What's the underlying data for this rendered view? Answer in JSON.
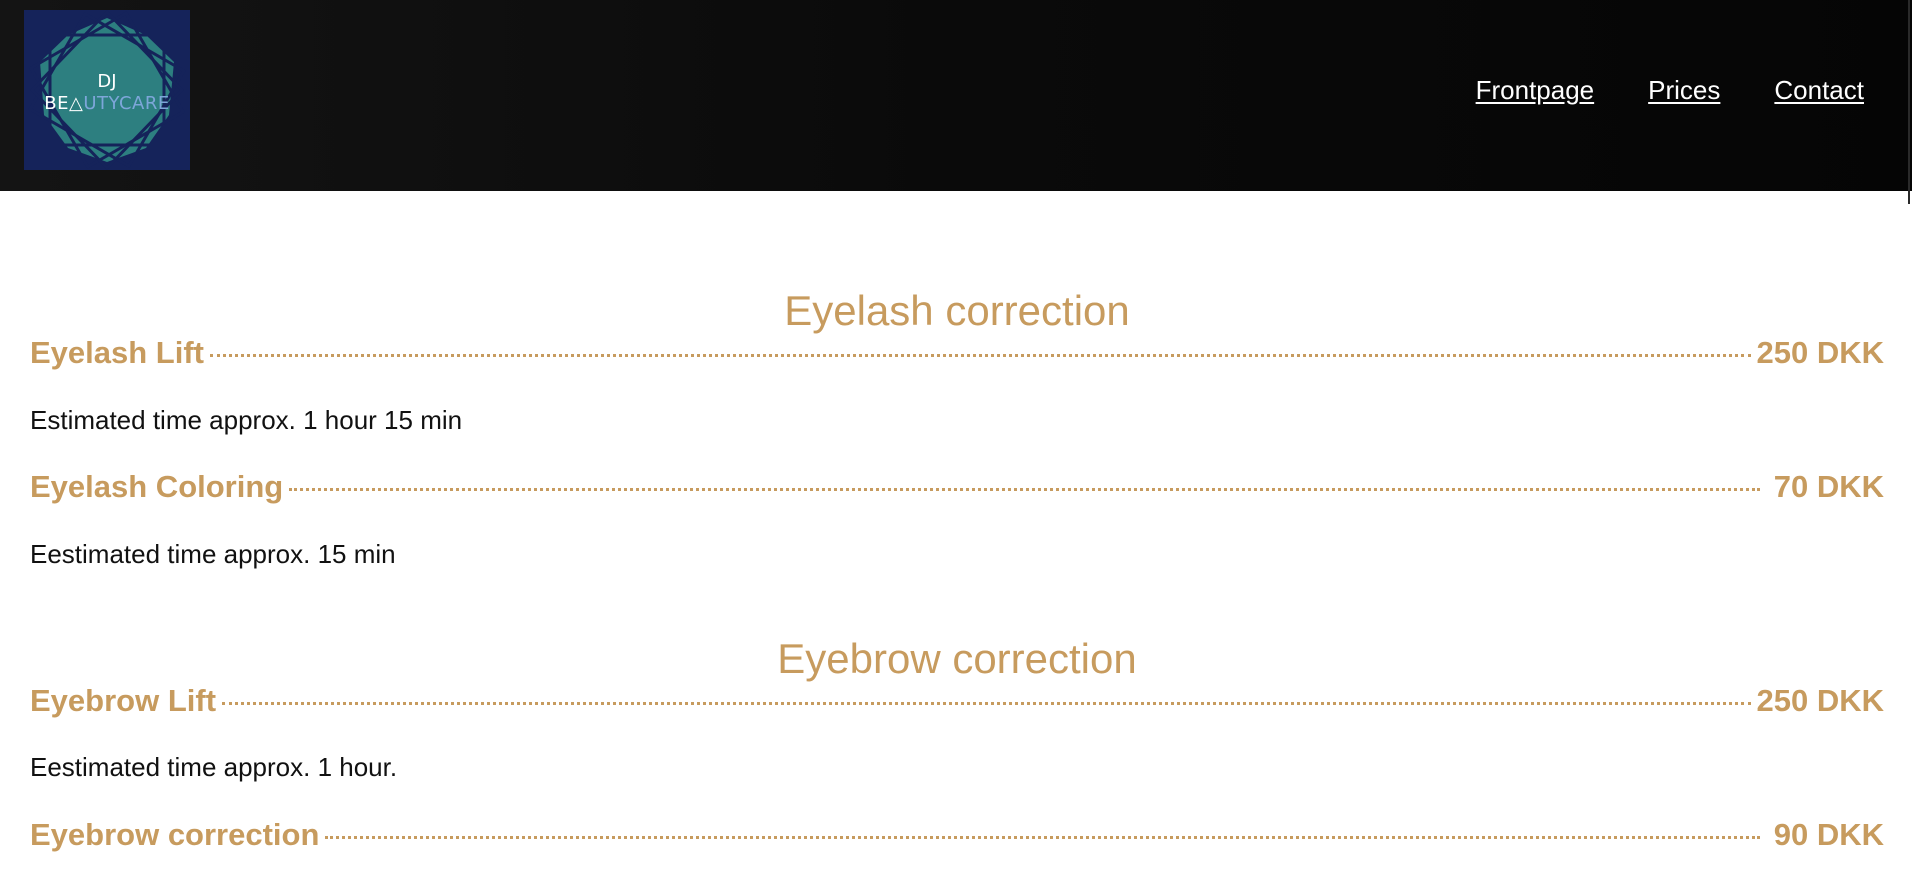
{
  "brand": {
    "logo_line1": "DJ",
    "logo_line2_white_a": "BE",
    "logo_line2_white_b": "A",
    "logo_line2_blue": "UTYCARE",
    "colors": {
      "logo_bg": "#15235a",
      "logo_square": "#2d7f80",
      "logo_lines": "#15235a",
      "accent_gold": "#c79b5e",
      "header_bg": "#0a0a0a"
    }
  },
  "nav": {
    "frontpage": "Frontpage",
    "prices": "Prices",
    "contact": "Contact"
  },
  "sections": [
    {
      "title": "Eyelash correction",
      "items": [
        {
          "name": "Eyelash Lift",
          "price": "250 DKK",
          "desc": "Estimated time approx. 1 hour 15 min"
        },
        {
          "name": "Eyelash Coloring",
          "price": "70 DKK",
          "desc": "Eestimated time approx. 15 min"
        }
      ]
    },
    {
      "title": "Eyebrow correction",
      "items": [
        {
          "name": "Eyebrow Lift",
          "price": "250 DKK",
          "desc": "Eestimated time approx. 1 hour."
        },
        {
          "name": "Eyebrow correction",
          "price": "90 DKK"
        }
      ]
    }
  ]
}
